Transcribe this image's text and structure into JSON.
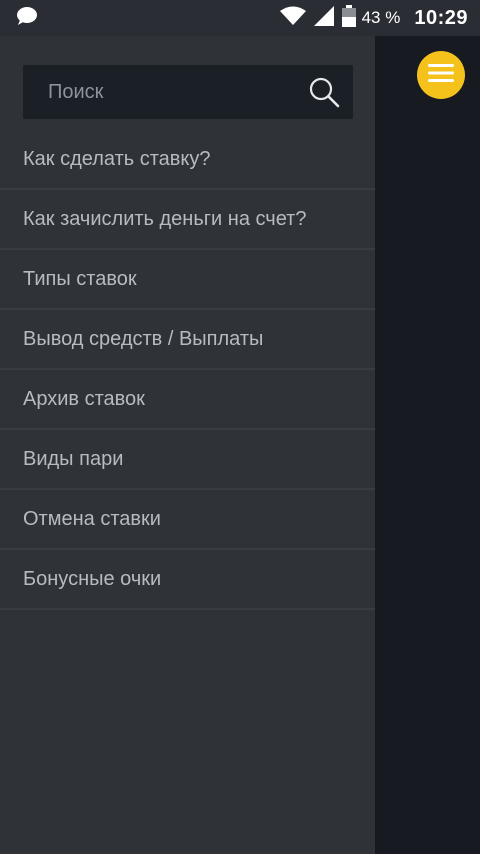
{
  "status_bar": {
    "battery_percent": "43 %",
    "time": "10:29",
    "icons": [
      "message-icon",
      "wifi-icon",
      "signal-icon",
      "battery-icon"
    ]
  },
  "colors": {
    "accent": "#f5c21b",
    "drawer_bg": "#2f3338",
    "search_bg": "#1b1f26",
    "page_bg": "#171b21"
  },
  "drawer": {
    "search": {
      "placeholder": "Поиск",
      "icon": "search-icon"
    },
    "items": [
      {
        "label": "Как сделать ставку?"
      },
      {
        "label": "Как зачислить деньги на счет?"
      },
      {
        "label": "Типы ставок"
      },
      {
        "label": "Вывод средств / Выплаты"
      },
      {
        "label": "Архив ставок"
      },
      {
        "label": "Виды пари"
      },
      {
        "label": "Отмена ставки"
      },
      {
        "label": "Бонусные очки"
      }
    ]
  },
  "menu_button": {
    "icon": "hamburger-menu-icon"
  }
}
